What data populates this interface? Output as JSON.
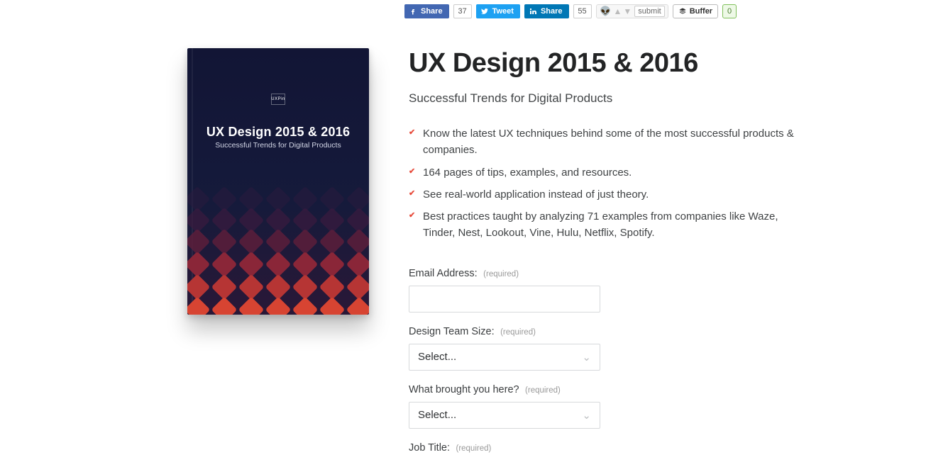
{
  "social": {
    "fb_label": "Share",
    "fb_count": "37",
    "tw_label": "Tweet",
    "li_label": "Share",
    "li_count": "55",
    "reddit_submit": "submit",
    "buffer_label": "Buffer",
    "buffer_count": "0"
  },
  "book": {
    "badge": "UXPin",
    "title": "UX Design 2015 & 2016",
    "subtitle": "Successful Trends for Digital Products"
  },
  "main": {
    "title": "UX Design 2015 & 2016",
    "subtitle": "Successful Trends for Digital Products",
    "bullets": [
      "Know the latest UX techniques behind some of the most successful products & companies.",
      "164 pages of tips, examples, and resources.",
      "See real-world application instead of just theory.",
      "Best practices taught by analyzing 71 examples from companies like Waze, Tinder, Nest, Lookout, Vine, Hulu, Netflix, Spotify."
    ]
  },
  "form": {
    "required": "(required)",
    "email_label": "Email Address:",
    "team_label": "Design Team Size:",
    "brought_label": "What brought you here?",
    "job_label": "Job Title:",
    "select_placeholder": "Select..."
  }
}
